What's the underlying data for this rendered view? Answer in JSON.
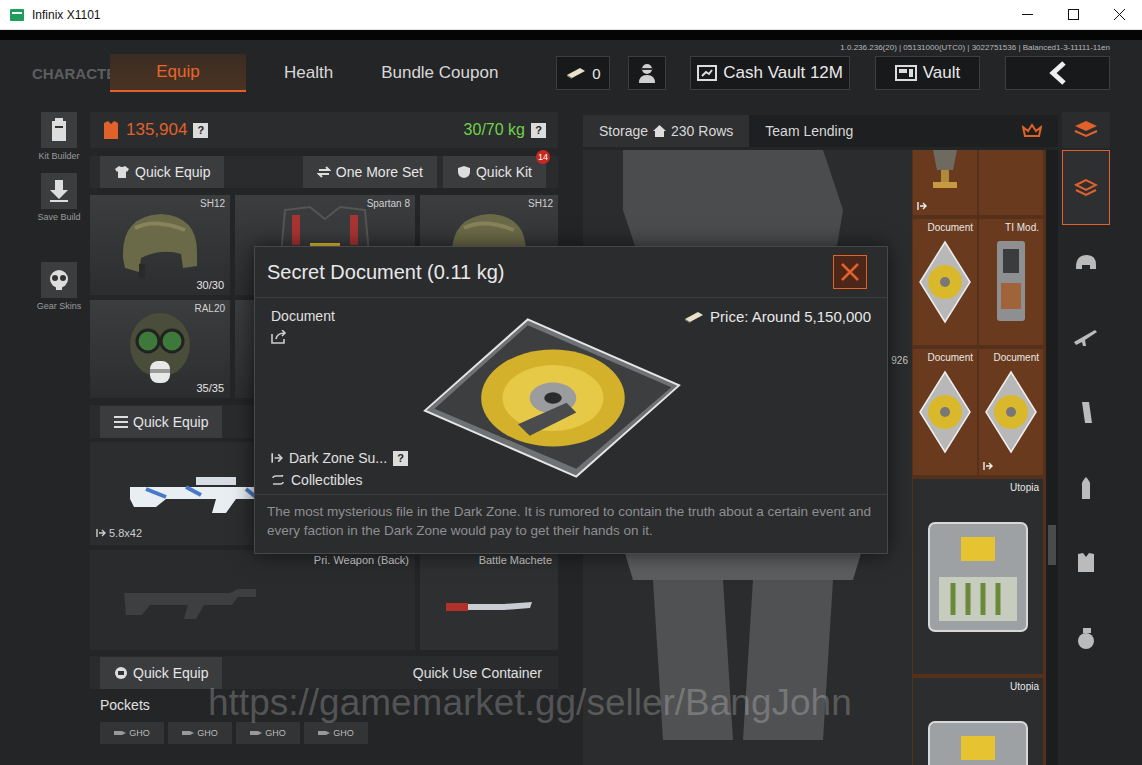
{
  "window": {
    "title": "Infinix X1101"
  },
  "version": "1.0.236.236(20) | 05131000(UTC0) | 3022751536 | Balanced1-3-11111-11en",
  "nav": {
    "section": "CHARACTER",
    "tabs": [
      {
        "label": "Equip",
        "selected": true
      },
      {
        "label": "Health",
        "selected": false
      },
      {
        "label": "Bundle Coupon",
        "selected": false
      }
    ],
    "currency": "0",
    "cash_vault": "Cash Vault 12M",
    "vault": "Vault"
  },
  "tools": [
    {
      "label": "Kit Builder",
      "kind": "kit"
    },
    {
      "label": "Save Build",
      "kind": "save"
    },
    {
      "label": "Gear Skins",
      "kind": "skins"
    }
  ],
  "loadout": {
    "armor": "135,904",
    "armor_help": "?",
    "weight": "30/70 kg",
    "weight_help": "?",
    "buttons": [
      {
        "label": "Quick Equip",
        "kind": "shirt"
      },
      {
        "label": "One More Set",
        "kind": "cycle"
      },
      {
        "label": "Quick Kit",
        "kind": "shield",
        "badge": "14"
      }
    ],
    "gear": [
      {
        "name": "SH12",
        "durability": "30/30",
        "kind": "helmet"
      },
      {
        "name": "Spartan 8",
        "kind": "vest"
      },
      {
        "name": "SH12",
        "kind": "helmet"
      },
      {
        "name": "RAL20",
        "durability": "35/35",
        "kind": "mask"
      }
    ],
    "primary": {
      "button": "Quick Equip",
      "caliber": "5.8x42"
    },
    "back": {
      "label": "Pri. Weapon (Back)",
      "melee": "Battle Machete"
    },
    "container": {
      "button": "Quick Equip",
      "label": "Quick Use Container"
    },
    "pockets": {
      "label": "Pockets",
      "slots": [
        "GHO",
        "GHO",
        "GHO",
        "GHO"
      ]
    }
  },
  "storage": {
    "tabs": [
      {
        "label": "Storage",
        "rows": "230 Rows",
        "selected": true
      },
      {
        "label": "Team Lending",
        "selected": false
      }
    ],
    "side_label": "926",
    "items": [
      {
        "label": "",
        "kind": "trophy",
        "exportable": true
      },
      {
        "label": "",
        "kind": "blank",
        "exportable": false
      },
      {
        "label": "Document",
        "kind": "disc",
        "exportable": false
      },
      {
        "label": "TI Mod.",
        "kind": "mod",
        "exportable": false
      },
      {
        "label": "Document",
        "kind": "disc",
        "exportable": false
      },
      {
        "label": "Document",
        "kind": "disc",
        "exportable": true
      },
      {
        "label": "Utopia",
        "kind": "case",
        "exportable": false
      },
      {
        "label": "Utopia",
        "kind": "case",
        "exportable": false
      }
    ]
  },
  "categories": [
    {
      "kind": "layers",
      "selected": true
    },
    {
      "kind": "helmet",
      "selected": false
    },
    {
      "kind": "rifle",
      "selected": false
    },
    {
      "kind": "magazine",
      "selected": false
    },
    {
      "kind": "bullet",
      "selected": false
    },
    {
      "kind": "vest",
      "selected": false
    },
    {
      "kind": "grenade",
      "selected": false
    }
  ],
  "modal": {
    "title": "Secret Document (0.11 kg)",
    "category": "Document",
    "price": "Price: Around 5,150,000",
    "source": "Dark Zone Su...",
    "source_help": "?",
    "collection": "Collectibles",
    "description": "The most mysterious file in the Dark Zone. It is rumored to contain the truth about a certain event and every faction in the Dark Zone would pay to get their hands on it."
  },
  "watermark": "https://gamemarket.gg/seller/BangJohn"
}
